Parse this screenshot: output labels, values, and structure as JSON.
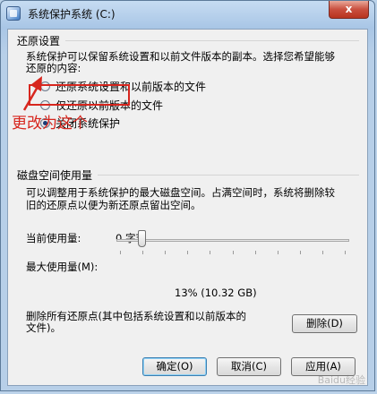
{
  "window": {
    "title": "系统保护系统 (C:)",
    "close_label": "x"
  },
  "restore_settings": {
    "group_title": "还原设置",
    "description_line1": "系统保护可以保留系统设置和以前文件版本的副本。选择您希望能够",
    "description_line2": "还原的内容:",
    "options": [
      {
        "label": "还原系统设置和以前版本的文件",
        "checked": false
      },
      {
        "label": "仅还原以前版本的文件",
        "checked": false
      },
      {
        "label": "关闭系统保护",
        "checked": true
      }
    ]
  },
  "annotation": {
    "text": "更改为这个",
    "color": "#d7261e"
  },
  "disk_usage": {
    "group_title": "磁盘空间使用量",
    "description_line1": "可以调整用于系统保护的最大磁盘空间。占满空间时，系统将删除较",
    "description_line2": "旧的还原点以便为新还原点留出空间。",
    "current_label": "当前使用量:",
    "current_value": "0 字节",
    "max_label": "最大使用量(M):",
    "slider_fraction": 0.13,
    "max_value": "13% (10.32 GB)",
    "delete_text_line1": "删除所有还原点(其中包括系统设置和以前版本的",
    "delete_text_line2": "文件)。",
    "delete_button": "删除(D)"
  },
  "footer": {
    "ok": "确定(O)",
    "cancel": "取消(C)",
    "apply": "应用(A)"
  },
  "watermark": "Baidu经验"
}
